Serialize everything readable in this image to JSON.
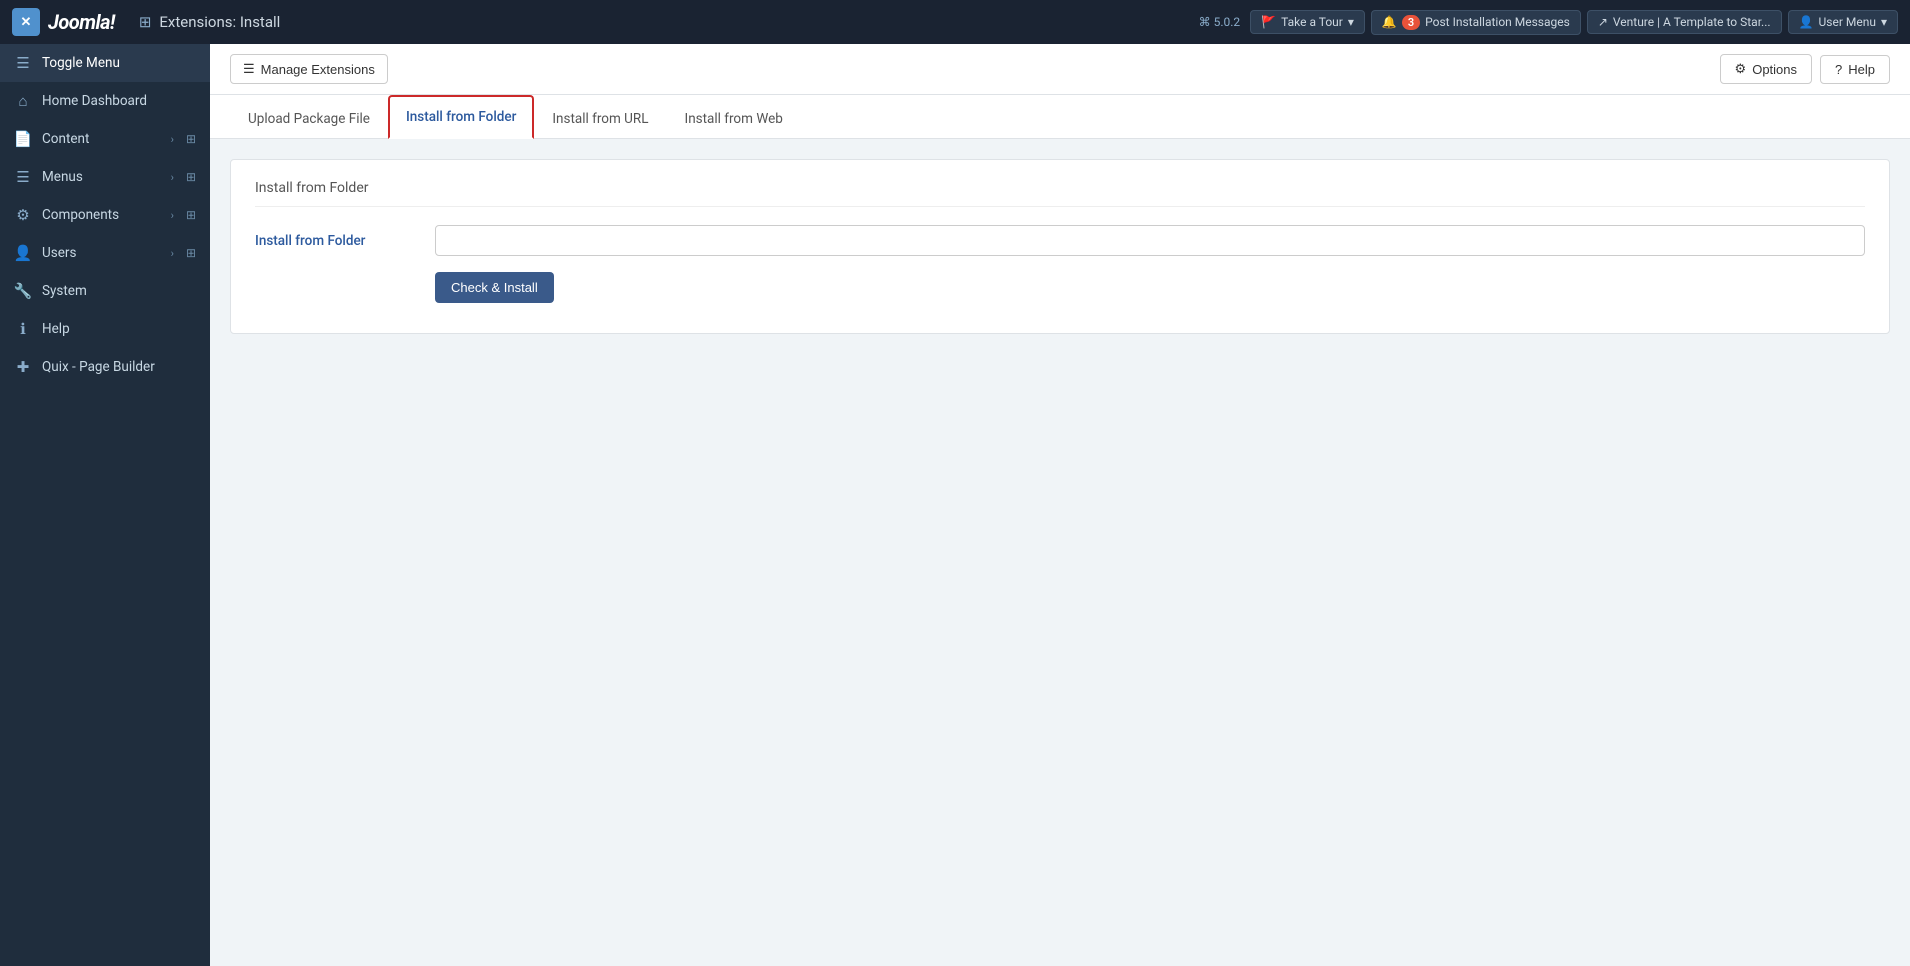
{
  "topbar": {
    "logo_text": "Joomla!",
    "title": "Extensions: Install",
    "title_icon": "⊞",
    "version": "⌘ 5.0.2",
    "take_tour_label": "Take a Tour",
    "notifications_count": "3",
    "post_installation_label": "Post Installation Messages",
    "venture_label": "Venture | A Template to Star...",
    "user_menu_label": "User Menu"
  },
  "sidebar": {
    "toggle_label": "Toggle Menu",
    "items": [
      {
        "id": "home-dashboard",
        "label": "Home Dashboard",
        "icon": "⌂",
        "has_chevron": false,
        "has_grid": false
      },
      {
        "id": "content",
        "label": "Content",
        "icon": "📄",
        "has_chevron": true,
        "has_grid": true
      },
      {
        "id": "menus",
        "label": "Menus",
        "icon": "☰",
        "has_chevron": true,
        "has_grid": true
      },
      {
        "id": "components",
        "label": "Components",
        "icon": "⚙",
        "has_chevron": true,
        "has_grid": true
      },
      {
        "id": "users",
        "label": "Users",
        "icon": "👤",
        "has_chevron": true,
        "has_grid": true
      },
      {
        "id": "system",
        "label": "System",
        "icon": "🔧",
        "has_chevron": false,
        "has_grid": false
      },
      {
        "id": "help",
        "label": "Help",
        "icon": "ℹ",
        "has_chevron": false,
        "has_grid": false
      },
      {
        "id": "quix-page-builder",
        "label": "Quix - Page Builder",
        "icon": "✚",
        "has_chevron": false,
        "has_grid": false
      }
    ]
  },
  "subheader": {
    "manage_extensions_label": "Manage Extensions",
    "options_label": "Options",
    "help_label": "Help"
  },
  "tabs": [
    {
      "id": "upload-package-file",
      "label": "Upload Package File",
      "active": false
    },
    {
      "id": "install-from-folder",
      "label": "Install from Folder",
      "active": true
    },
    {
      "id": "install-from-url",
      "label": "Install from URL",
      "active": false
    },
    {
      "id": "install-from-web",
      "label": "Install from Web",
      "active": false
    }
  ],
  "install_panel": {
    "title": "Install from Folder",
    "folder_label": "Install from Folder",
    "folder_placeholder": "",
    "button_label": "Check & Install"
  }
}
